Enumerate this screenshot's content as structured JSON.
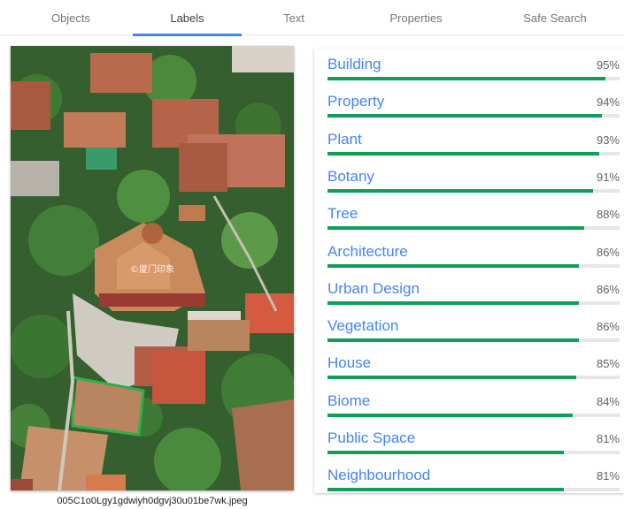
{
  "tabs": [
    {
      "label": "Objects",
      "active": false
    },
    {
      "label": "Labels",
      "active": true
    },
    {
      "label": "Text",
      "active": false
    },
    {
      "label": "Properties",
      "active": false
    },
    {
      "label": "Safe Search",
      "active": false
    }
  ],
  "image": {
    "filename": "005C1o0Lgy1gdwiyh0dgvj30u01be7wk.jpeg",
    "watermark": "©厦门印象"
  },
  "colors": {
    "accent": "#4285f4",
    "bar_fill": "#0f9d58",
    "bar_track": "#e6e6e6"
  },
  "labels": [
    {
      "name": "Building",
      "score_text": "95%",
      "score": 0.95
    },
    {
      "name": "Property",
      "score_text": "94%",
      "score": 0.94
    },
    {
      "name": "Plant",
      "score_text": "93%",
      "score": 0.93
    },
    {
      "name": "Botany",
      "score_text": "91%",
      "score": 0.91
    },
    {
      "name": "Tree",
      "score_text": "88%",
      "score": 0.88
    },
    {
      "name": "Architecture",
      "score_text": "86%",
      "score": 0.86
    },
    {
      "name": "Urban Design",
      "score_text": "86%",
      "score": 0.86
    },
    {
      "name": "Vegetation",
      "score_text": "86%",
      "score": 0.86
    },
    {
      "name": "House",
      "score_text": "85%",
      "score": 0.85
    },
    {
      "name": "Biome",
      "score_text": "84%",
      "score": 0.84
    },
    {
      "name": "Public Space",
      "score_text": "81%",
      "score": 0.81
    },
    {
      "name": "Neighbourhood",
      "score_text": "81%",
      "score": 0.81
    }
  ]
}
